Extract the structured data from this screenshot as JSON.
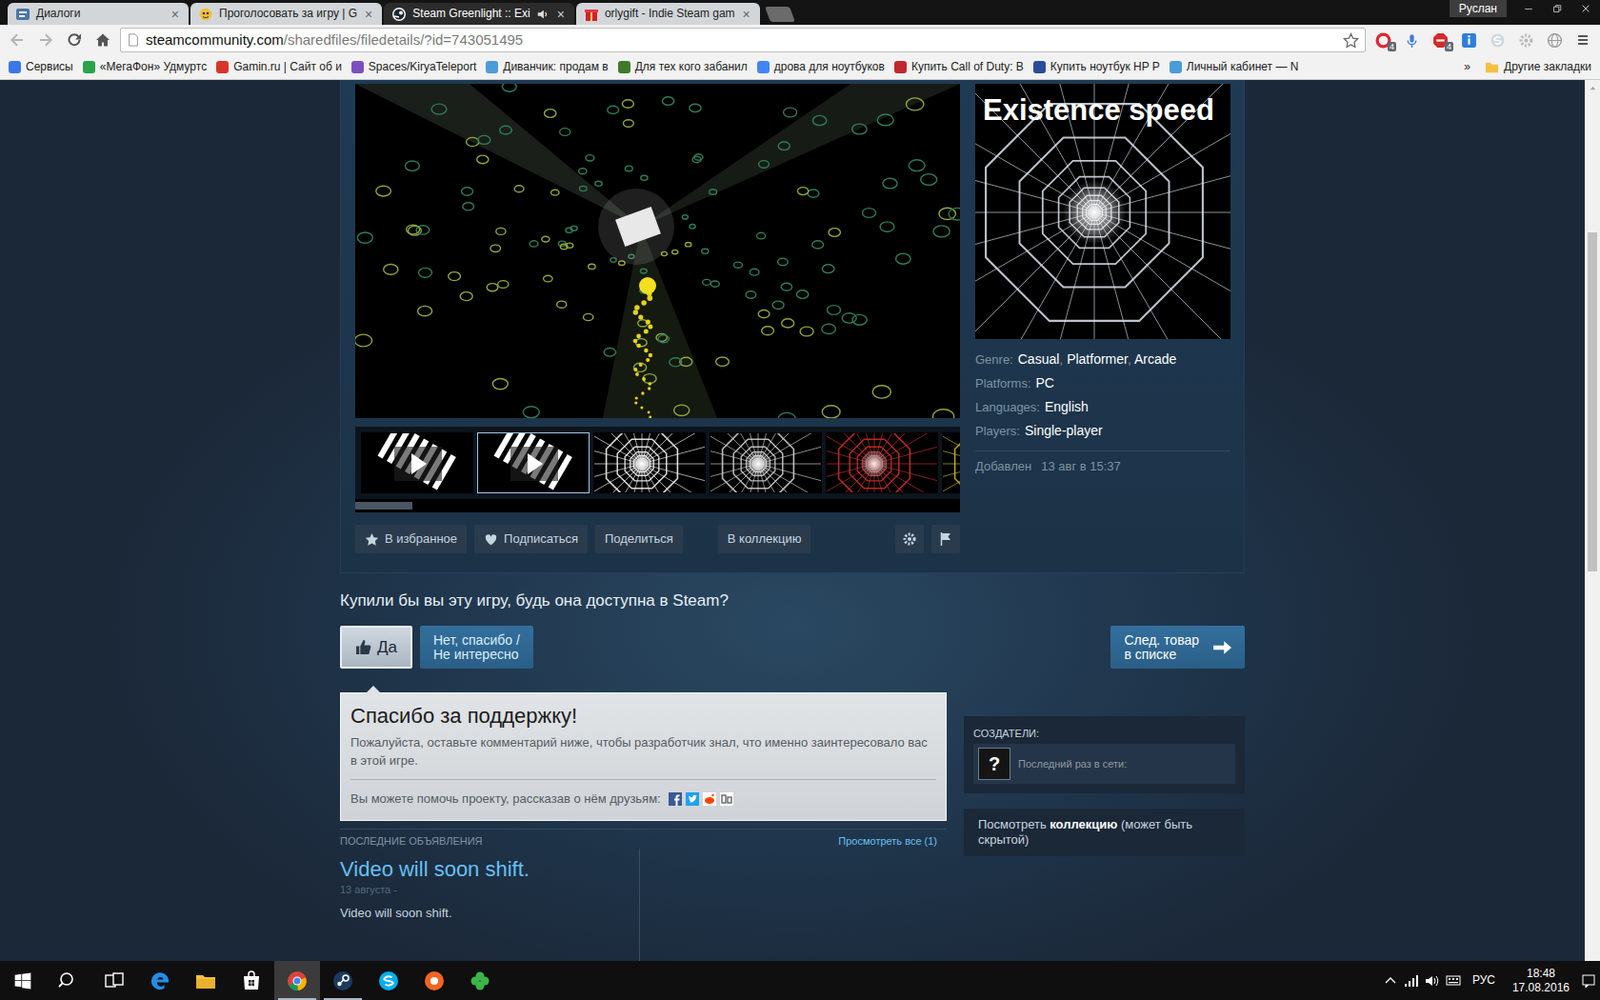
{
  "browser": {
    "tabs": [
      {
        "label": "Диалоги",
        "selected": false,
        "kind": "vk",
        "audio": false
      },
      {
        "label": "Проголосовать за игру | G",
        "selected": false,
        "kind": "game",
        "audio": false
      },
      {
        "label": "Steam Greenlight :: Exi",
        "selected": true,
        "kind": "steam",
        "audio": true
      },
      {
        "label": "orlygift - Indie Steam gam",
        "selected": false,
        "kind": "gift",
        "audio": false
      }
    ],
    "tab_close": "×",
    "user": "Руслан",
    "address": {
      "host": "steamcommunity.com",
      "path": "/sharedfiles/filedetails/?id=743051495"
    },
    "extensions": [
      {
        "kind": "opera",
        "badge": "4"
      },
      {
        "kind": "mic"
      },
      {
        "kind": "abp",
        "badge": "4"
      },
      {
        "kind": "info"
      },
      {
        "kind": "skype"
      },
      {
        "kind": "gear"
      },
      {
        "kind": "globe"
      }
    ],
    "bookmarks": [
      {
        "label": "Сервисы",
        "color": "#3b78e7"
      },
      {
        "label": "«МегаФон» Удмуртс",
        "color": "#2aa34a"
      },
      {
        "label": "Gamin.ru | Сайт об и",
        "color": "#d9342b"
      },
      {
        "label": "Spaces/KiryaTeleport",
        "color": "#7b4fbf"
      },
      {
        "label": "Диванчик: продам в",
        "color": "#4a9bd9"
      },
      {
        "label": "Для тех кого забанил",
        "color": "#3f7a2a"
      },
      {
        "label": "дрова для ноутбуков",
        "color": "#4285f4"
      },
      {
        "label": "Купить Call of Duty: B",
        "color": "#c0282d"
      },
      {
        "label": "Купить ноутбук HP P",
        "color": "#2b4c9b"
      },
      {
        "label": "Личный кабинет — N",
        "color": "#4a9bd9"
      }
    ],
    "bookmarks_more": "»",
    "other_bookmarks": "Другие закладки"
  },
  "media": {
    "capsule_title": "Existence speed",
    "thumbnails": [
      {
        "kind": "video",
        "selected": false,
        "color": "#ffffff"
      },
      {
        "kind": "video",
        "selected": true,
        "color": "#ffffff"
      },
      {
        "kind": "image",
        "selected": false,
        "color": "#ffffff"
      },
      {
        "kind": "image",
        "selected": false,
        "color": "#d8d8d8"
      },
      {
        "kind": "image",
        "selected": false,
        "color": "#d03030"
      },
      {
        "kind": "image",
        "selected": false,
        "color": "#c8c020"
      }
    ],
    "strip_scroll": {
      "level": 0.095
    }
  },
  "actions": {
    "buttons": [
      {
        "label": "В избранное",
        "kind": "favorite"
      },
      {
        "label": "Подписаться",
        "kind": "follow"
      },
      {
        "label": "Поделиться",
        "kind": "share"
      },
      {
        "label": "В коллекцию",
        "kind": "collection"
      }
    ],
    "tools": [
      {
        "kind": "settings"
      },
      {
        "kind": "report"
      }
    ]
  },
  "details": {
    "rows": [
      {
        "label": "Genre:",
        "values": [
          "Casual",
          "Platformer",
          "Arcade"
        ]
      },
      {
        "label": "Platforms:",
        "values": [
          "PC"
        ]
      },
      {
        "label": "Languages:",
        "values": [
          "English"
        ]
      },
      {
        "label": "Players:",
        "values": [
          "Single-player"
        ]
      }
    ],
    "separator": ", ",
    "added": {
      "label": "Добавлен",
      "value": "13 авг в 15:37"
    }
  },
  "vote": {
    "question": "Купили бы вы эту игру, будь она доступна в Steam?",
    "yes": {
      "label": "Да",
      "selected": true
    },
    "no": {
      "lines": [
        "Нет, спасибо /",
        "Не интересно"
      ],
      "selected": false
    },
    "next": {
      "lines": [
        "След. товар",
        "в списке"
      ]
    }
  },
  "thanks": {
    "title": "Спасибо за поддержку!",
    "text": "Пожалуйста, оставьте комментарий ниже, чтобы разработчик знал, что именно заинтересовало вас в этой игре.",
    "share": "Вы можете помочь проекту, рассказав о нём друзьям:",
    "social": [
      {
        "kind": "facebook"
      },
      {
        "kind": "twitter"
      },
      {
        "kind": "reddit"
      },
      {
        "kind": "digg"
      }
    ]
  },
  "announcements": {
    "header": "ПОСЛЕДНИЕ ОБЪЯВЛЕНИЯ",
    "view_all": "Просмотреть все (1)",
    "items": [
      {
        "title": "Video will soon shift.",
        "date": "13 августа -",
        "body": "Video will soon shift."
      }
    ]
  },
  "creators": {
    "header": "СОЗДАТЕЛИ:",
    "avatar": "?",
    "status": "Последний раз в сети:"
  },
  "collection": {
    "before": "Посмотреть ",
    "link": "коллекцию",
    "after": " (может быть скрытой)"
  },
  "page_scrollbar": {
    "start": 0.173,
    "level": 0.385
  },
  "taskbar": {
    "apps": [
      {
        "kind": "start",
        "active": false,
        "running": false
      },
      {
        "kind": "search",
        "active": false,
        "running": false
      },
      {
        "kind": "taskview",
        "active": false,
        "running": false
      },
      {
        "kind": "edge",
        "active": false,
        "running": false
      },
      {
        "kind": "explorer",
        "active": false,
        "running": false
      },
      {
        "kind": "store",
        "active": false,
        "running": false
      },
      {
        "kind": "chrome",
        "active": true,
        "running": true
      },
      {
        "kind": "steam",
        "active": false,
        "running": true
      },
      {
        "kind": "skype",
        "active": false,
        "running": false
      },
      {
        "kind": "orange",
        "active": false,
        "running": false
      },
      {
        "kind": "clover",
        "active": false,
        "running": false
      }
    ],
    "language": "РУС",
    "time": "18:48",
    "date": "17.08.2016"
  }
}
